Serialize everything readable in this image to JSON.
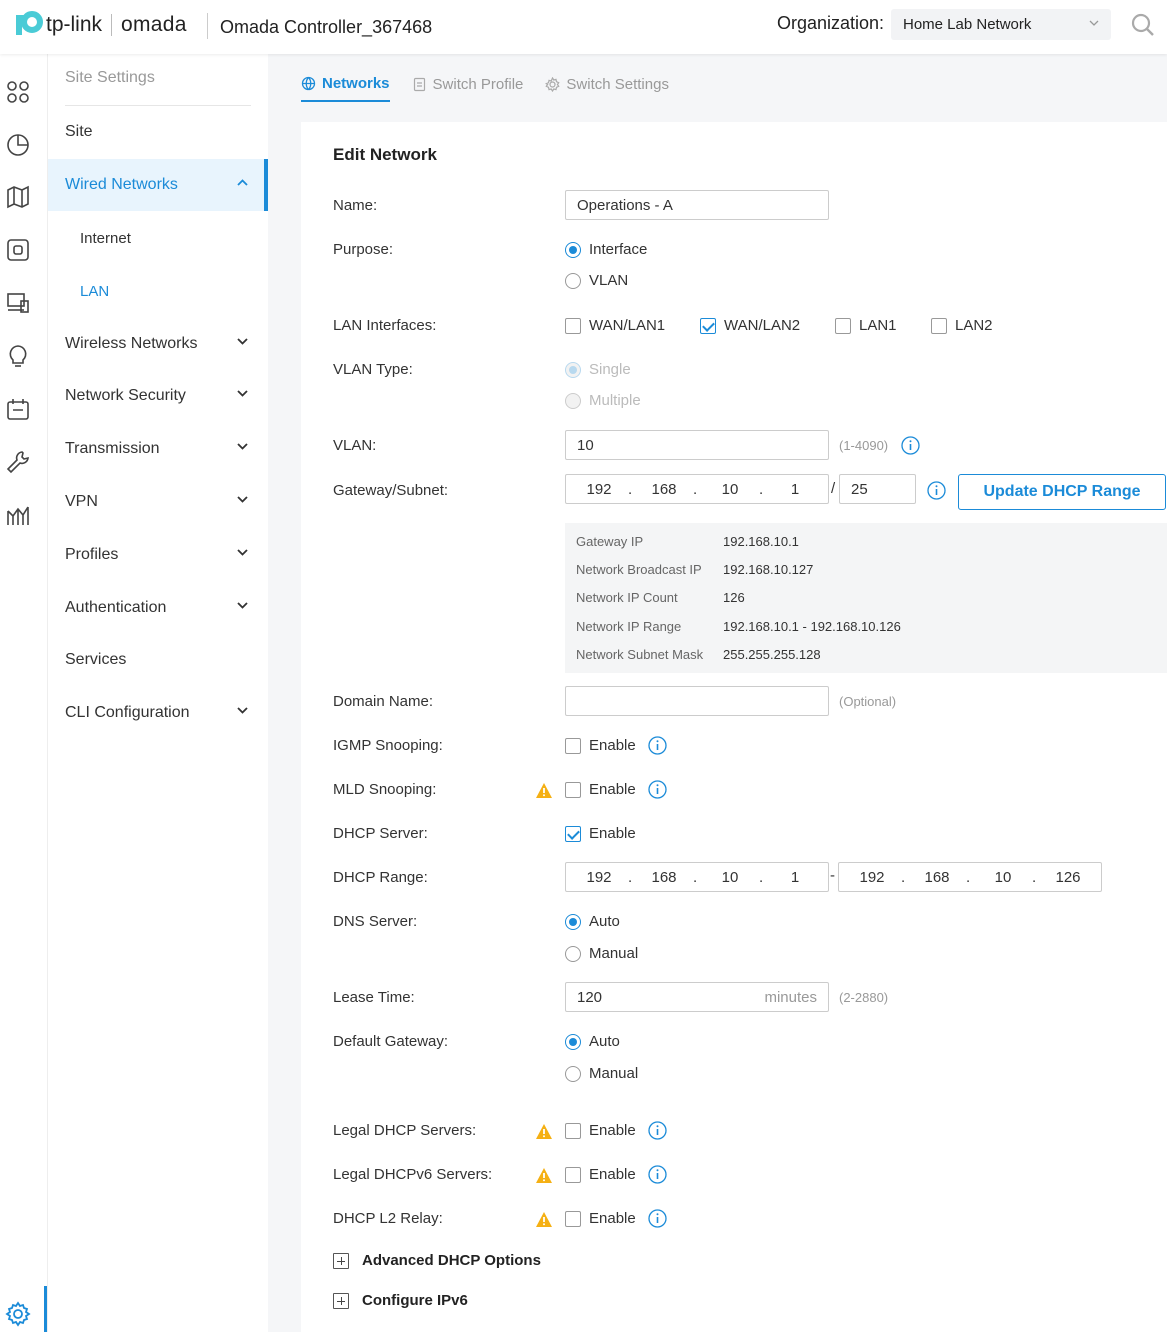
{
  "header": {
    "brand_tp": "tp-link",
    "brand_omada": "omada",
    "controller_name": "Omada Controller_367468",
    "org_label": "Organization:",
    "org_value": "Home Lab Network"
  },
  "sidebar": {
    "heading": "Site Settings",
    "items": [
      {
        "label": "Site"
      },
      {
        "label": "Wired Networks"
      },
      {
        "label": "Internet"
      },
      {
        "label": "LAN"
      },
      {
        "label": "Wireless Networks"
      },
      {
        "label": "Network Security"
      },
      {
        "label": "Transmission"
      },
      {
        "label": "VPN"
      },
      {
        "label": "Profiles"
      },
      {
        "label": "Authentication"
      },
      {
        "label": "Services"
      },
      {
        "label": "CLI Configuration"
      }
    ]
  },
  "tabs": [
    {
      "label": "Networks"
    },
    {
      "label": "Switch Profile"
    },
    {
      "label": "Switch Settings"
    }
  ],
  "form": {
    "title": "Edit Network",
    "name_label": "Name:",
    "name_value": "Operations - A",
    "purpose_label": "Purpose:",
    "purpose_opts": [
      "Interface",
      "VLAN"
    ],
    "lan_label": "LAN Interfaces:",
    "lan_opts": [
      "WAN/LAN1",
      "WAN/LAN2",
      "LAN1",
      "LAN2"
    ],
    "vlantype_label": "VLAN Type:",
    "vlantype_opts": [
      "Single",
      "Multiple"
    ],
    "vlan_label": "VLAN:",
    "vlan_value": "10",
    "vlan_hint": "(1-4090)",
    "gw_label": "Gateway/Subnet:",
    "gw_ip": [
      "192",
      "168",
      "10",
      "1"
    ],
    "gw_mask": "25",
    "update_btn": "Update DHCP Range",
    "info": [
      {
        "k": "Gateway IP",
        "v": "192.168.10.1"
      },
      {
        "k": "Network Broadcast IP",
        "v": "192.168.10.127"
      },
      {
        "k": "Network IP Count",
        "v": "126"
      },
      {
        "k": "Network IP Range",
        "v": "192.168.10.1 - 192.168.10.126"
      },
      {
        "k": "Network Subnet Mask",
        "v": "255.255.255.128"
      }
    ],
    "domain_label": "Domain Name:",
    "domain_hint": "(Optional)",
    "igmp_label": "IGMP Snooping:",
    "mld_label": "MLD Snooping:",
    "dhcp_label": "DHCP Server:",
    "enable": "Enable",
    "range_label": "DHCP Range:",
    "range_start": [
      "192",
      "168",
      "10",
      "1"
    ],
    "range_end": [
      "192",
      "168",
      "10",
      "126"
    ],
    "dns_label": "DNS Server:",
    "opt_auto": "Auto",
    "opt_manual": "Manual",
    "lease_label": "Lease Time:",
    "lease_value": "120",
    "lease_unit": "minutes",
    "lease_hint": "(2-2880)",
    "defgw_label": "Default Gateway:",
    "legal_label": "Legal DHCP Servers:",
    "legal6_label": "Legal DHCPv6 Servers:",
    "relay_label": "DHCP L2 Relay:",
    "adv_label": "Advanced DHCP Options",
    "ipv6_label": "Configure IPv6"
  }
}
